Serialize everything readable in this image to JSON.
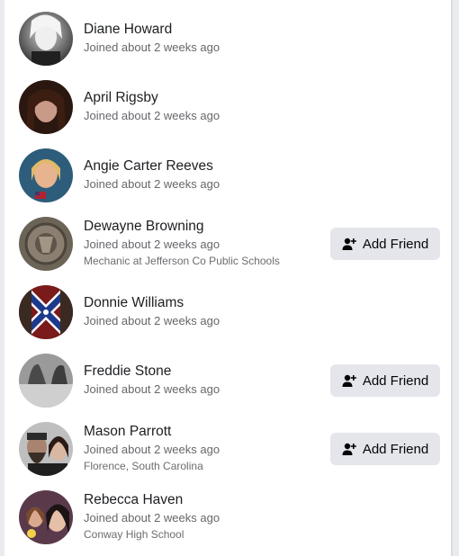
{
  "members": [
    {
      "name": "Diane Howard",
      "joined": "Joined about 2 weeks ago",
      "extra": "",
      "add_friend": "",
      "avatar": "member-avatar"
    },
    {
      "name": "April Rigsby",
      "joined": "Joined about 2 weeks ago",
      "extra": "",
      "add_friend": "",
      "avatar": "member-avatar"
    },
    {
      "name": "Angie Carter Reeves",
      "joined": "Joined about 2 weeks ago",
      "extra": "",
      "add_friend": "",
      "avatar": "member-avatar"
    },
    {
      "name": "Dewayne Browning",
      "joined": "Joined about 2 weeks ago",
      "extra": "Mechanic at Jefferson Co Public Schools",
      "add_friend": "Add Friend",
      "avatar": "member-avatar"
    },
    {
      "name": "Donnie Williams",
      "joined": "Joined about 2 weeks ago",
      "extra": "",
      "add_friend": "",
      "avatar": "member-avatar"
    },
    {
      "name": "Freddie Stone",
      "joined": "Joined about 2 weeks ago",
      "extra": "",
      "add_friend": "Add Friend",
      "avatar": "member-avatar"
    },
    {
      "name": "Mason Parrott",
      "joined": "Joined about 2 weeks ago",
      "extra": "Florence, South Carolina",
      "add_friend": "Add Friend",
      "avatar": "member-avatar"
    },
    {
      "name": "Rebecca Haven",
      "joined": "Joined about 2 weeks ago",
      "extra": "Conway High School",
      "add_friend": "",
      "avatar": "member-avatar"
    }
  ],
  "icons": {
    "add_friend_icon": "person-add-icon"
  },
  "colors": {
    "button_bg": "#e4e6eb",
    "name_text": "#1c1e21",
    "secondary_text": "#65676b"
  }
}
